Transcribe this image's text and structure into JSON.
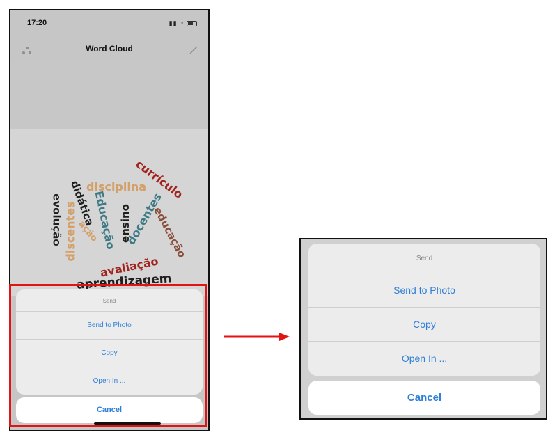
{
  "status_bar": {
    "time": "17:20"
  },
  "nav": {
    "title": "Word Cloud"
  },
  "word_cloud": {
    "words": [
      {
        "text": "currículo",
        "color": "#a0231d"
      },
      {
        "text": "disciplina",
        "color": "#d3a06a"
      },
      {
        "text": "didática",
        "color": "#1e1e1e"
      },
      {
        "text": "evolução",
        "color": "#1e1e1e"
      },
      {
        "text": "discentes",
        "color": "#d3a06a"
      },
      {
        "text": "ação",
        "color": "#d3a06a"
      },
      {
        "text": "Educação",
        "color": "#3d7a86"
      },
      {
        "text": "ensino",
        "color": "#1e1e1e"
      },
      {
        "text": "docentes",
        "color": "#3d7a86"
      },
      {
        "text": "educação",
        "color": "#8a4f3a"
      },
      {
        "text": "avaliação",
        "color": "#a0231d"
      },
      {
        "text": "aprendizagem",
        "color": "#1e1e1e"
      }
    ]
  },
  "action_sheet": {
    "title": "Send",
    "items": [
      "Send to Photo",
      "Copy",
      "Open In ..."
    ],
    "cancel": "Cancel"
  },
  "colors": {
    "accent": "#2f7fd7",
    "highlight": "#e11414"
  }
}
